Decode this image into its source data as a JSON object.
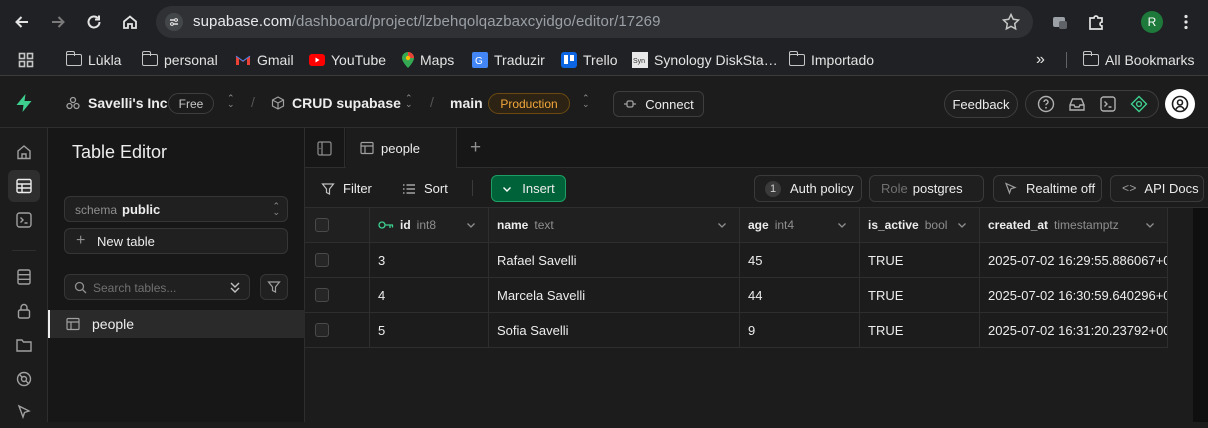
{
  "browser": {
    "url_host": "supabase.com",
    "url_path": "/dashboard/project/lzbehqolqazbaxcyidgo/editor/17269",
    "profile_initial": "R"
  },
  "bookmarks": {
    "items": [
      "Lùkla",
      "personal",
      "Gmail",
      "YouTube",
      "Maps",
      "Traduzir",
      "Trello",
      "Synology DiskSta…",
      "Importado"
    ],
    "overflow": "»",
    "all": "All Bookmarks"
  },
  "header": {
    "org": "Savelli's Inc",
    "org_plan": "Free",
    "project": "CRUD supabase",
    "branch": "main",
    "branch_badge": "Production",
    "connect": "Connect",
    "feedback": "Feedback"
  },
  "sidebar": {
    "title": "Table Editor",
    "schema_label": "schema",
    "schema_value": "public",
    "new_table": "New table",
    "search_placeholder": "Search tables...",
    "tables": [
      "people"
    ]
  },
  "tabs": {
    "active": "people",
    "add": "+"
  },
  "toolbar": {
    "filter": "Filter",
    "sort": "Sort",
    "insert": "Insert",
    "auth_count": "1",
    "auth_policy": "Auth policy",
    "role_label": "Role",
    "role_value": "postgres",
    "realtime": "Realtime off",
    "api_docs": "API Docs"
  },
  "grid": {
    "columns": [
      {
        "name": "id",
        "type": "int8",
        "pk": true
      },
      {
        "name": "name",
        "type": "text"
      },
      {
        "name": "age",
        "type": "int4"
      },
      {
        "name": "is_active",
        "type": "bool"
      },
      {
        "name": "created_at",
        "type": "timestamptz"
      }
    ],
    "rows": [
      [
        "3",
        "Rafael Savelli",
        "45",
        "TRUE",
        "2025-07-02 16:29:55.886067+0"
      ],
      [
        "4",
        "Marcela Savelli",
        "44",
        "TRUE",
        "2025-07-02 16:30:59.640296+0"
      ],
      [
        "5",
        "Sofia Savelli",
        "9",
        "TRUE",
        "2025-07-02 16:31:20.23792+00"
      ]
    ]
  },
  "colors": {
    "accent": "#3ecf8e",
    "insert_bg": "#006239",
    "production_badge": "#f3a83b"
  }
}
